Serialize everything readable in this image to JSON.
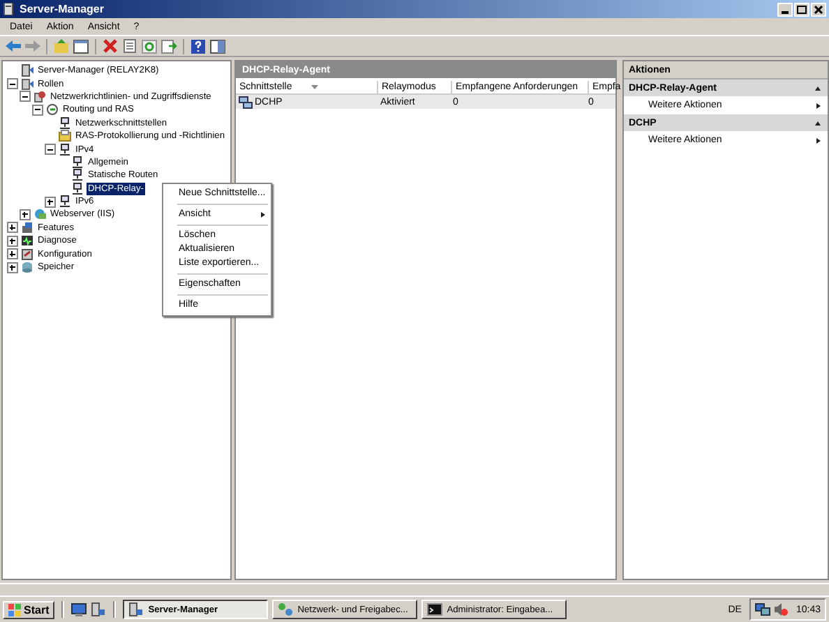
{
  "window": {
    "title": "Server-Manager"
  },
  "menu": [
    "Datei",
    "Aktion",
    "Ansicht",
    "?"
  ],
  "tree": [
    {
      "label": "Server-Manager (RELAY2K8)",
      "kind": "server",
      "selected": false
    },
    {
      "label": "Rollen",
      "kind": "roles",
      "expanded": true,
      "selected": false,
      "children": [
        {
          "label": "Netzwerkrichtlinien- und Zugriffsdienste",
          "kind": "policy",
          "expanded": true,
          "selected": false,
          "children": [
            {
              "label": "Routing und RAS",
              "kind": "routing",
              "expanded": true,
              "selected": false,
              "children": [
                {
                  "label": "Netzwerkschnittstellen",
                  "kind": "net",
                  "selected": false
                },
                {
                  "label": "RAS-Protokollierung und -Richtlinien",
                  "kind": "log",
                  "selected": false
                },
                {
                  "label": "IPv4",
                  "kind": "net",
                  "expanded": true,
                  "selected": false,
                  "children": [
                    {
                      "label": "Allgemein",
                      "kind": "net",
                      "selected": false
                    },
                    {
                      "label": "Statische Routen",
                      "kind": "net",
                      "selected": false
                    },
                    {
                      "label": "DHCP-Relay-",
                      "kind": "net",
                      "selected": true
                    }
                  ]
                },
                {
                  "label": "IPv6",
                  "kind": "net",
                  "expanded": false,
                  "selected": false
                }
              ]
            }
          ]
        },
        {
          "label": "Webserver (IIS)",
          "kind": "web",
          "expanded": false,
          "selected": false
        }
      ]
    },
    {
      "label": "Features",
      "kind": "features",
      "expanded": false,
      "selected": false
    },
    {
      "label": "Diagnose",
      "kind": "diagnose",
      "expanded": false,
      "selected": false
    },
    {
      "label": "Konfiguration",
      "kind": "config",
      "expanded": false,
      "selected": false
    },
    {
      "label": "Speicher",
      "kind": "storage",
      "expanded": false,
      "selected": false
    }
  ],
  "center": {
    "title": "DHCP-Relay-Agent",
    "columns": [
      "Schnittstelle",
      "Relaymodus",
      "Empfangene Anforderungen",
      "Empfa"
    ],
    "rows": [
      {
        "cells": [
          "DCHP",
          "Aktiviert",
          "0",
          "0"
        ],
        "selected": true
      }
    ]
  },
  "actions": {
    "title": "Aktionen",
    "sections": [
      {
        "title": "DHCP-Relay-Agent",
        "expanded": true,
        "items": [
          {
            "label": "Weitere Aktionen",
            "submenu": true
          }
        ]
      },
      {
        "title": "DCHP",
        "expanded": true,
        "items": [
          {
            "label": "Weitere Aktionen",
            "submenu": true
          }
        ]
      }
    ]
  },
  "context_menu": [
    {
      "kind": "item",
      "label": "Neue Schnittstelle..."
    },
    {
      "kind": "separator"
    },
    {
      "kind": "item",
      "label": "Ansicht",
      "submenu": true
    },
    {
      "kind": "separator"
    },
    {
      "kind": "item",
      "label": "Löschen"
    },
    {
      "kind": "item",
      "label": "Aktualisieren"
    },
    {
      "kind": "item",
      "label": "Liste exportieren..."
    },
    {
      "kind": "separator"
    },
    {
      "kind": "item",
      "label": "Eigenschaften"
    },
    {
      "kind": "separator"
    },
    {
      "kind": "item",
      "label": "Hilfe"
    }
  ],
  "taskbar": {
    "start": "Start",
    "tasks": [
      {
        "label": "Server-Manager",
        "selected": true
      },
      {
        "label": "Netzwerk- und Freigabec...",
        "selected": false
      },
      {
        "label": "Administrator: Eingabea...",
        "selected": false
      }
    ],
    "language": "DE",
    "clock": "10:43"
  }
}
